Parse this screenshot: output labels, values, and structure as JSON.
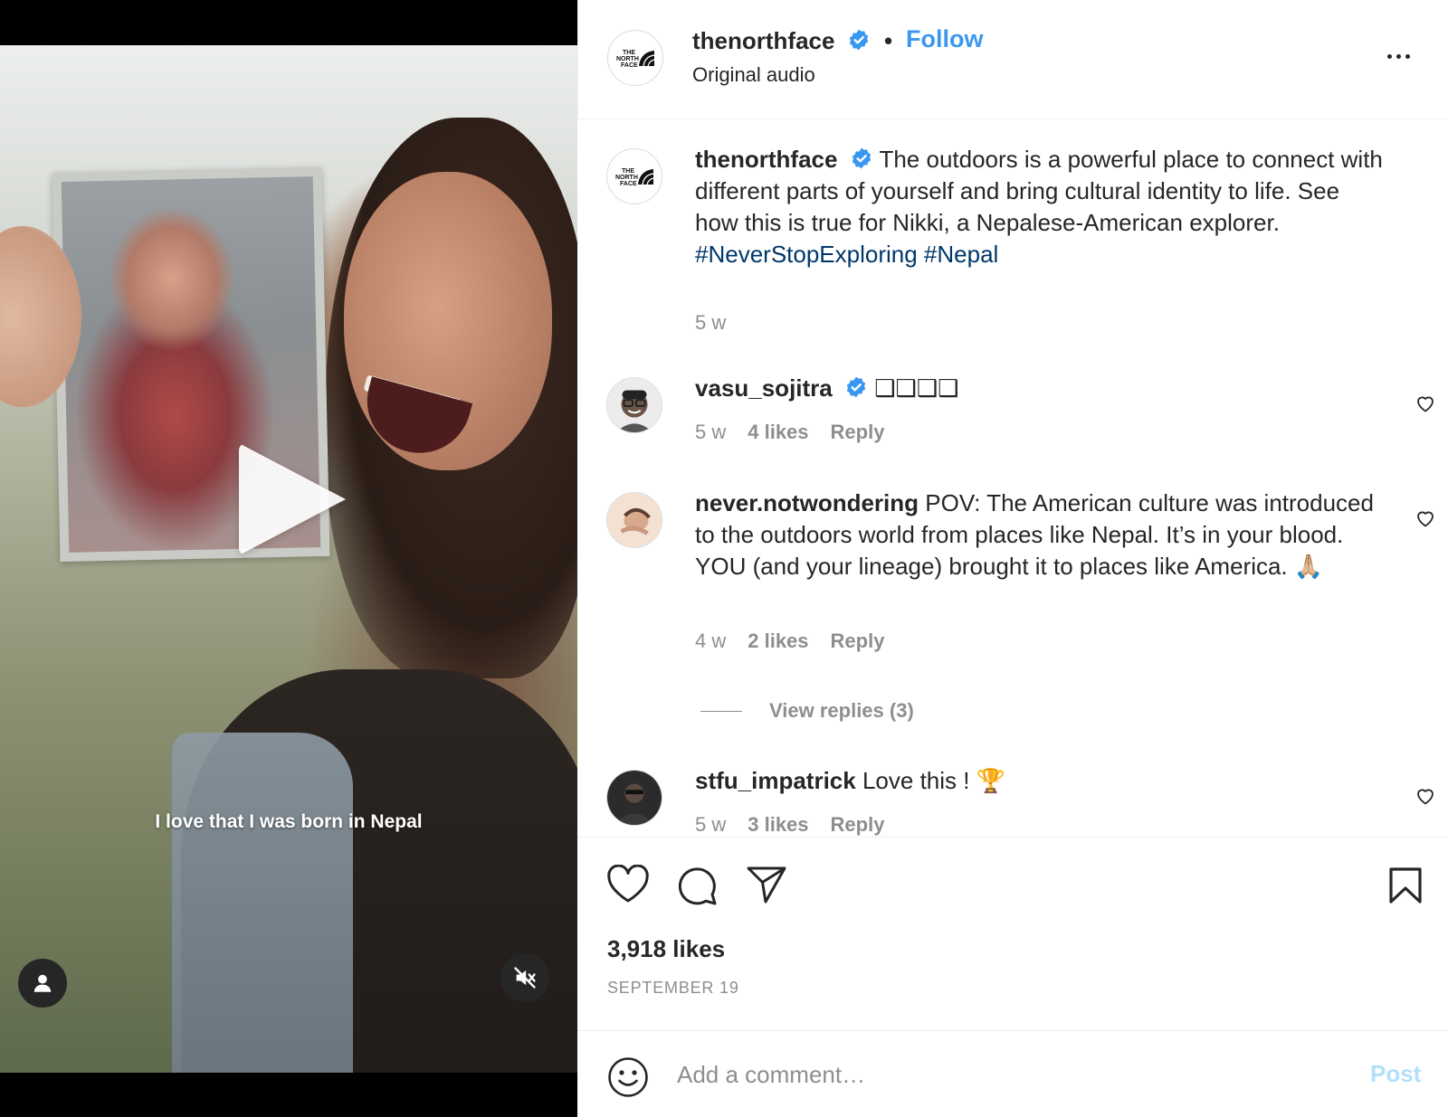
{
  "video": {
    "caption": "I love that I was born in Nepal"
  },
  "header": {
    "username": "thenorthface",
    "separator": "•",
    "follow_label": "Follow",
    "audio": "Original audio"
  },
  "post": {
    "username": "thenorthface",
    "text": "The outdoors is a powerful place to connect with different parts of yourself and bring cultural identity to life. See how this is true for Nikki, a Nepalese-American explorer.",
    "hashtags": "#NeverStopExploring #Nepal",
    "age": "5 w"
  },
  "comments": [
    {
      "username": "vasu_sojitra",
      "text": "❑❑❑❑",
      "age": "5 w",
      "likes": "4 likes",
      "reply": "Reply"
    },
    {
      "username": "never.notwondering",
      "text": "POV: The American culture was introduced to the outdoors world from places like Nepal. It’s in your blood. YOU (and your lineage) brought it to places like America. 🙏🏼",
      "age": "4 w",
      "likes": "2 likes",
      "reply": "Reply",
      "view_replies": "View replies (3)"
    },
    {
      "username": "stfu_impatrick",
      "text": "Love this ! 🏆",
      "age": "5 w",
      "likes": "3 likes",
      "reply": "Reply"
    }
  ],
  "footer": {
    "likes": "3,918 likes",
    "date": "SEPTEMBER 19",
    "comment_placeholder": "Add a comment…",
    "post_label": "Post"
  },
  "colors": {
    "accent": "#3d97f0",
    "hashtag": "#00376b",
    "muted": "#8e8e8e",
    "post_disabled": "#b2dffc",
    "verified": "#3897f0"
  }
}
